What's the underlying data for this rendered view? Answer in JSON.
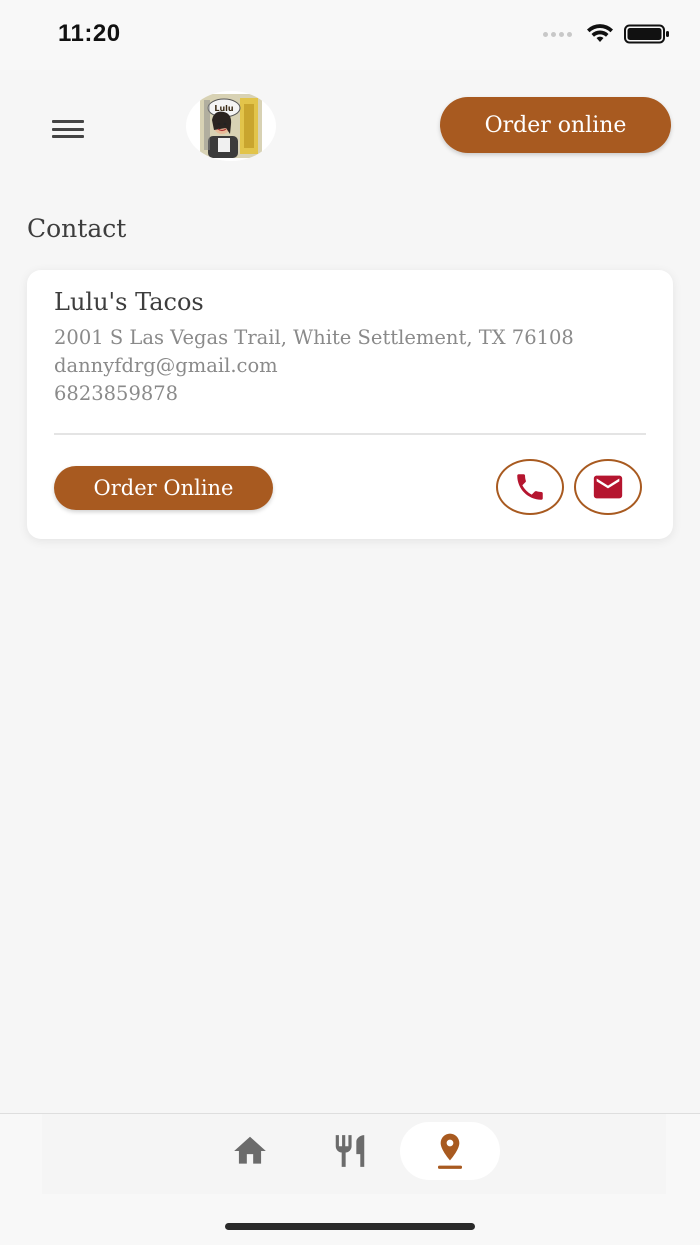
{
  "status_bar": {
    "time": "11:20"
  },
  "header": {
    "menu_icon": "hamburger-icon",
    "logo_text": "Lulu's",
    "order_button": "Order online"
  },
  "page": {
    "title": "Contact"
  },
  "contact_card": {
    "name": "Lulu's Tacos",
    "address": "2001 S Las Vegas Trail, White Settlement, TX 76108",
    "email": "dannyfdrg@gmail.com",
    "phone": "6823859878",
    "order_button": "Order Online",
    "phone_icon": "phone-icon",
    "mail_icon": "mail-icon"
  },
  "bottom_nav": {
    "items": [
      {
        "icon": "home-icon",
        "active": false
      },
      {
        "icon": "fork-knife-icon",
        "active": false
      },
      {
        "icon": "location-pin-icon",
        "active": true
      }
    ]
  },
  "colors": {
    "accent": "#a85a20",
    "icon_red": "#b5152f",
    "background": "#f6f6f6",
    "card": "#ffffff",
    "nav_inactive": "#6b6b6b"
  }
}
